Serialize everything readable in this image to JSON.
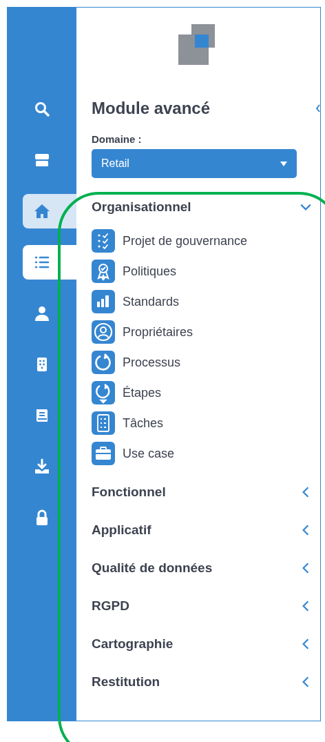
{
  "sidebar": {
    "items": [
      {
        "selected": false,
        "hovered": false
      },
      {
        "selected": false,
        "hovered": false
      },
      {
        "selected": false,
        "hovered": true
      },
      {
        "selected": true,
        "hovered": false
      },
      {
        "selected": false,
        "hovered": false
      },
      {
        "selected": false,
        "hovered": false
      },
      {
        "selected": false,
        "hovered": false
      },
      {
        "selected": false,
        "hovered": false
      },
      {
        "selected": false,
        "hovered": false
      }
    ]
  },
  "panel": {
    "title": "Module avancé",
    "domain": {
      "label": "Domaine :",
      "value": "Retail"
    },
    "sections": [
      {
        "label": "Organisationnel",
        "expanded": true,
        "children": [
          {
            "label": "Projet de gouvernance"
          },
          {
            "label": "Politiques"
          },
          {
            "label": "Standards"
          },
          {
            "label": "Propriétaires"
          },
          {
            "label": "Processus"
          },
          {
            "label": "Étapes"
          },
          {
            "label": "Tâches"
          },
          {
            "label": "Use case"
          }
        ]
      },
      {
        "label": "Fonctionnel",
        "expanded": false
      },
      {
        "label": "Applicatif",
        "expanded": false
      },
      {
        "label": "Qualité de données",
        "expanded": false
      },
      {
        "label": "RGPD",
        "expanded": false
      },
      {
        "label": "Cartographie",
        "expanded": false
      },
      {
        "label": "Restitution",
        "expanded": false
      }
    ]
  }
}
